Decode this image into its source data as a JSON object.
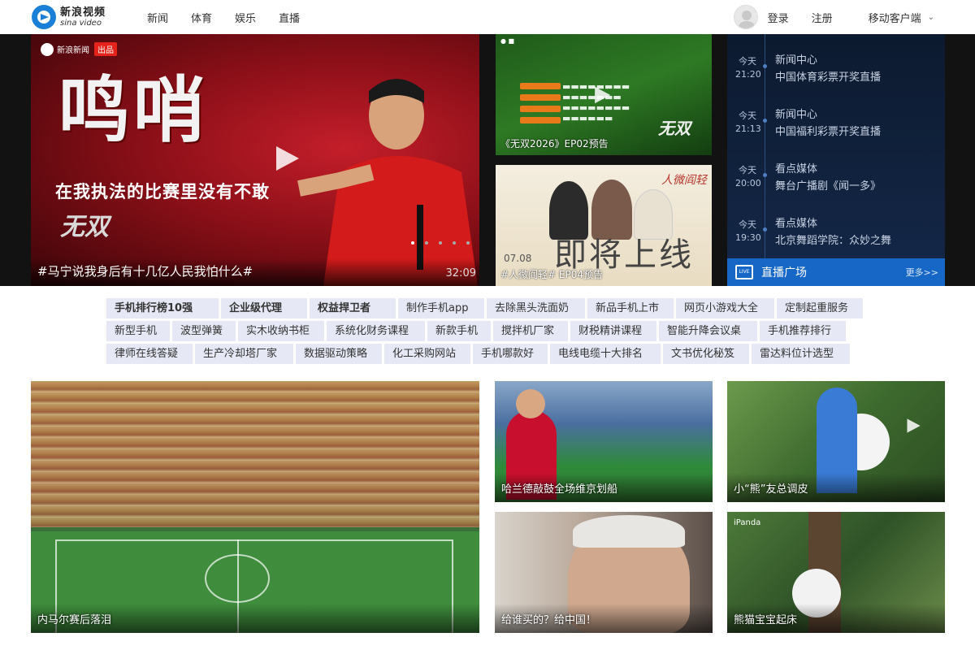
{
  "brand": {
    "name_cn": "新浪视频",
    "name_en": "sina video"
  },
  "nav": {
    "items": [
      "新闻",
      "体育",
      "娱乐",
      "直播"
    ]
  },
  "header": {
    "login": "登录",
    "register": "注册",
    "mobile": "移动客户端"
  },
  "hero": {
    "main": {
      "logo_text": "新浪新闻",
      "logo_tag": "出品",
      "headline_big": "鸣哨",
      "headline_sub": "在我执法的比赛里没有不敢",
      "brand_overlay": "无双",
      "caption": "#马宁说我身后有十几亿人民我怕什么#",
      "duration": "32:09"
    },
    "side": [
      {
        "caption": "《无双2026》EP02预告",
        "overlay_brand": "无双"
      },
      {
        "caption": "#人微阎轻# EP04预告",
        "overlay_big": "即将上线",
        "overlay_date": "07.08",
        "overlay_title": "人微阎轻"
      }
    ]
  },
  "live": {
    "items": [
      {
        "day": "今天",
        "time": "21:20",
        "channel": "新闻中心",
        "program": "中国体育彩票开奖直播"
      },
      {
        "day": "今天",
        "time": "21:13",
        "channel": "新闻中心",
        "program": "中国福利彩票开奖直播"
      },
      {
        "day": "今天",
        "time": "20:00",
        "channel": "看点媒体",
        "program": "舞台广播剧《闻一多》"
      },
      {
        "day": "今天",
        "time": "19:30",
        "channel": "看点媒体",
        "program": "北京舞蹈学院：众妙之舞"
      }
    ],
    "footer_icon": "LIVE",
    "footer_title": "直播广场",
    "footer_more": "更多>>"
  },
  "keywords": {
    "rows": [
      [
        "手机排行榜10强",
        "企业级代理",
        "权益捍卫者",
        "制作手机app",
        "去除黑头洗面奶",
        "新品手机上市",
        "网页小游戏大全",
        "定制起重服务"
      ],
      [
        "新型手机",
        "波型弹簧",
        "实木收纳书柜",
        "系统化财务课程",
        "新款手机",
        "搅拌机厂家",
        "财税精讲课程",
        "智能升降会议桌",
        "手机推荐排行"
      ],
      [
        "律师在线答疑",
        "生产冷却塔厂家",
        "数据驱动策略",
        "化工采购网站",
        "手机哪款好",
        "电线电缆十大排名",
        "文书优化秘笈",
        "雷达料位计选型"
      ]
    ],
    "bold_count": 3
  },
  "grid": {
    "big_caption": "内马尔赛后落泪",
    "small": [
      {
        "caption": "哈兰德敲鼓全场维京划船"
      },
      {
        "caption": "小“熊”友总调皮"
      },
      {
        "caption": "给谁买的？给中国！"
      },
      {
        "caption": "熊猫宝宝起床",
        "logo": "iPanda"
      }
    ]
  },
  "colors": {
    "accent": "#1667c6",
    "hero_bg": "#121212",
    "keyword_bg": "#e6e9f5"
  }
}
